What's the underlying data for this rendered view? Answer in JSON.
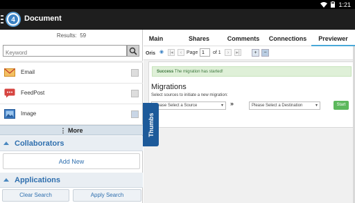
{
  "status_bar": {
    "time": "1:21"
  },
  "app_bar": {
    "title": "Document"
  },
  "left_panel": {
    "results_label": "Results:",
    "results_count": "59",
    "search": {
      "placeholder": "Keyword",
      "value": ""
    },
    "items": [
      {
        "label": "Email",
        "icon": "email-icon",
        "icon_color": "#e8a33a",
        "checked": false
      },
      {
        "label": "FeedPost",
        "icon": "feedpost-icon",
        "icon_color": "#d64541",
        "checked": false
      },
      {
        "label": "Image",
        "icon": "image-icon",
        "icon_color": "#3b7bc4",
        "checked": false
      }
    ],
    "more_label": "⋮ More",
    "collaborators_header": "Collaborators",
    "add_new_label": "Add New",
    "applications_header": "Applications",
    "clear_search_label": "Clear Search",
    "apply_search_label": "Apply Search"
  },
  "thumbs_label": "Thumbs",
  "tabs": [
    {
      "label": "Main",
      "active": false
    },
    {
      "label": "Shares",
      "active": false
    },
    {
      "label": "Comments",
      "active": false
    },
    {
      "label": "Connections",
      "active": false
    },
    {
      "label": "Previewer",
      "active": true
    }
  ],
  "viewer": {
    "brand": "Oris",
    "page_label": "Page",
    "page_value": "1",
    "of_label": "of 1",
    "success_title": "Success",
    "success_text": "The migration has started!",
    "heading": "Migrations",
    "subheading": "Select sources to initiate a new migration:",
    "source_select": "Please Select a Source",
    "dest_select": "Please Select a Destination",
    "arrows": "»",
    "start_label": "Start"
  },
  "colors": {
    "accent": "#2f6fae",
    "tab_active": "#48a8d8",
    "thumbs_tab": "#1d5a9a",
    "start_button": "#5cb85c"
  }
}
